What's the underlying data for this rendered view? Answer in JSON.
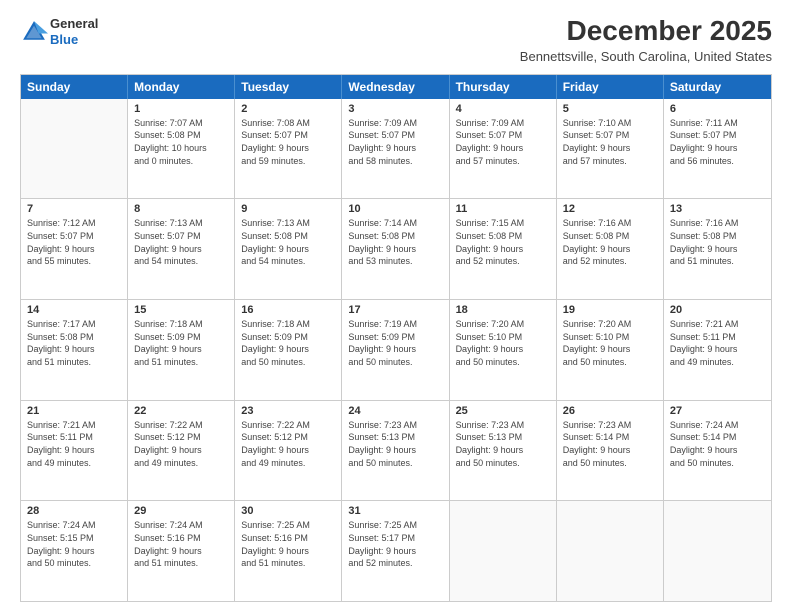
{
  "header": {
    "logo_general": "General",
    "logo_blue": "Blue",
    "month_title": "December 2025",
    "location": "Bennettsville, South Carolina, United States"
  },
  "days_of_week": [
    "Sunday",
    "Monday",
    "Tuesday",
    "Wednesday",
    "Thursday",
    "Friday",
    "Saturday"
  ],
  "weeks": [
    [
      {
        "day": "",
        "info": ""
      },
      {
        "day": "1",
        "info": "Sunrise: 7:07 AM\nSunset: 5:08 PM\nDaylight: 10 hours\nand 0 minutes."
      },
      {
        "day": "2",
        "info": "Sunrise: 7:08 AM\nSunset: 5:07 PM\nDaylight: 9 hours\nand 59 minutes."
      },
      {
        "day": "3",
        "info": "Sunrise: 7:09 AM\nSunset: 5:07 PM\nDaylight: 9 hours\nand 58 minutes."
      },
      {
        "day": "4",
        "info": "Sunrise: 7:09 AM\nSunset: 5:07 PM\nDaylight: 9 hours\nand 57 minutes."
      },
      {
        "day": "5",
        "info": "Sunrise: 7:10 AM\nSunset: 5:07 PM\nDaylight: 9 hours\nand 57 minutes."
      },
      {
        "day": "6",
        "info": "Sunrise: 7:11 AM\nSunset: 5:07 PM\nDaylight: 9 hours\nand 56 minutes."
      }
    ],
    [
      {
        "day": "7",
        "info": "Sunrise: 7:12 AM\nSunset: 5:07 PM\nDaylight: 9 hours\nand 55 minutes."
      },
      {
        "day": "8",
        "info": "Sunrise: 7:13 AM\nSunset: 5:07 PM\nDaylight: 9 hours\nand 54 minutes."
      },
      {
        "day": "9",
        "info": "Sunrise: 7:13 AM\nSunset: 5:08 PM\nDaylight: 9 hours\nand 54 minutes."
      },
      {
        "day": "10",
        "info": "Sunrise: 7:14 AM\nSunset: 5:08 PM\nDaylight: 9 hours\nand 53 minutes."
      },
      {
        "day": "11",
        "info": "Sunrise: 7:15 AM\nSunset: 5:08 PM\nDaylight: 9 hours\nand 52 minutes."
      },
      {
        "day": "12",
        "info": "Sunrise: 7:16 AM\nSunset: 5:08 PM\nDaylight: 9 hours\nand 52 minutes."
      },
      {
        "day": "13",
        "info": "Sunrise: 7:16 AM\nSunset: 5:08 PM\nDaylight: 9 hours\nand 51 minutes."
      }
    ],
    [
      {
        "day": "14",
        "info": "Sunrise: 7:17 AM\nSunset: 5:08 PM\nDaylight: 9 hours\nand 51 minutes."
      },
      {
        "day": "15",
        "info": "Sunrise: 7:18 AM\nSunset: 5:09 PM\nDaylight: 9 hours\nand 51 minutes."
      },
      {
        "day": "16",
        "info": "Sunrise: 7:18 AM\nSunset: 5:09 PM\nDaylight: 9 hours\nand 50 minutes."
      },
      {
        "day": "17",
        "info": "Sunrise: 7:19 AM\nSunset: 5:09 PM\nDaylight: 9 hours\nand 50 minutes."
      },
      {
        "day": "18",
        "info": "Sunrise: 7:20 AM\nSunset: 5:10 PM\nDaylight: 9 hours\nand 50 minutes."
      },
      {
        "day": "19",
        "info": "Sunrise: 7:20 AM\nSunset: 5:10 PM\nDaylight: 9 hours\nand 50 minutes."
      },
      {
        "day": "20",
        "info": "Sunrise: 7:21 AM\nSunset: 5:11 PM\nDaylight: 9 hours\nand 49 minutes."
      }
    ],
    [
      {
        "day": "21",
        "info": "Sunrise: 7:21 AM\nSunset: 5:11 PM\nDaylight: 9 hours\nand 49 minutes."
      },
      {
        "day": "22",
        "info": "Sunrise: 7:22 AM\nSunset: 5:12 PM\nDaylight: 9 hours\nand 49 minutes."
      },
      {
        "day": "23",
        "info": "Sunrise: 7:22 AM\nSunset: 5:12 PM\nDaylight: 9 hours\nand 49 minutes."
      },
      {
        "day": "24",
        "info": "Sunrise: 7:23 AM\nSunset: 5:13 PM\nDaylight: 9 hours\nand 50 minutes."
      },
      {
        "day": "25",
        "info": "Sunrise: 7:23 AM\nSunset: 5:13 PM\nDaylight: 9 hours\nand 50 minutes."
      },
      {
        "day": "26",
        "info": "Sunrise: 7:23 AM\nSunset: 5:14 PM\nDaylight: 9 hours\nand 50 minutes."
      },
      {
        "day": "27",
        "info": "Sunrise: 7:24 AM\nSunset: 5:14 PM\nDaylight: 9 hours\nand 50 minutes."
      }
    ],
    [
      {
        "day": "28",
        "info": "Sunrise: 7:24 AM\nSunset: 5:15 PM\nDaylight: 9 hours\nand 50 minutes."
      },
      {
        "day": "29",
        "info": "Sunrise: 7:24 AM\nSunset: 5:16 PM\nDaylight: 9 hours\nand 51 minutes."
      },
      {
        "day": "30",
        "info": "Sunrise: 7:25 AM\nSunset: 5:16 PM\nDaylight: 9 hours\nand 51 minutes."
      },
      {
        "day": "31",
        "info": "Sunrise: 7:25 AM\nSunset: 5:17 PM\nDaylight: 9 hours\nand 52 minutes."
      },
      {
        "day": "",
        "info": ""
      },
      {
        "day": "",
        "info": ""
      },
      {
        "day": "",
        "info": ""
      }
    ]
  ]
}
